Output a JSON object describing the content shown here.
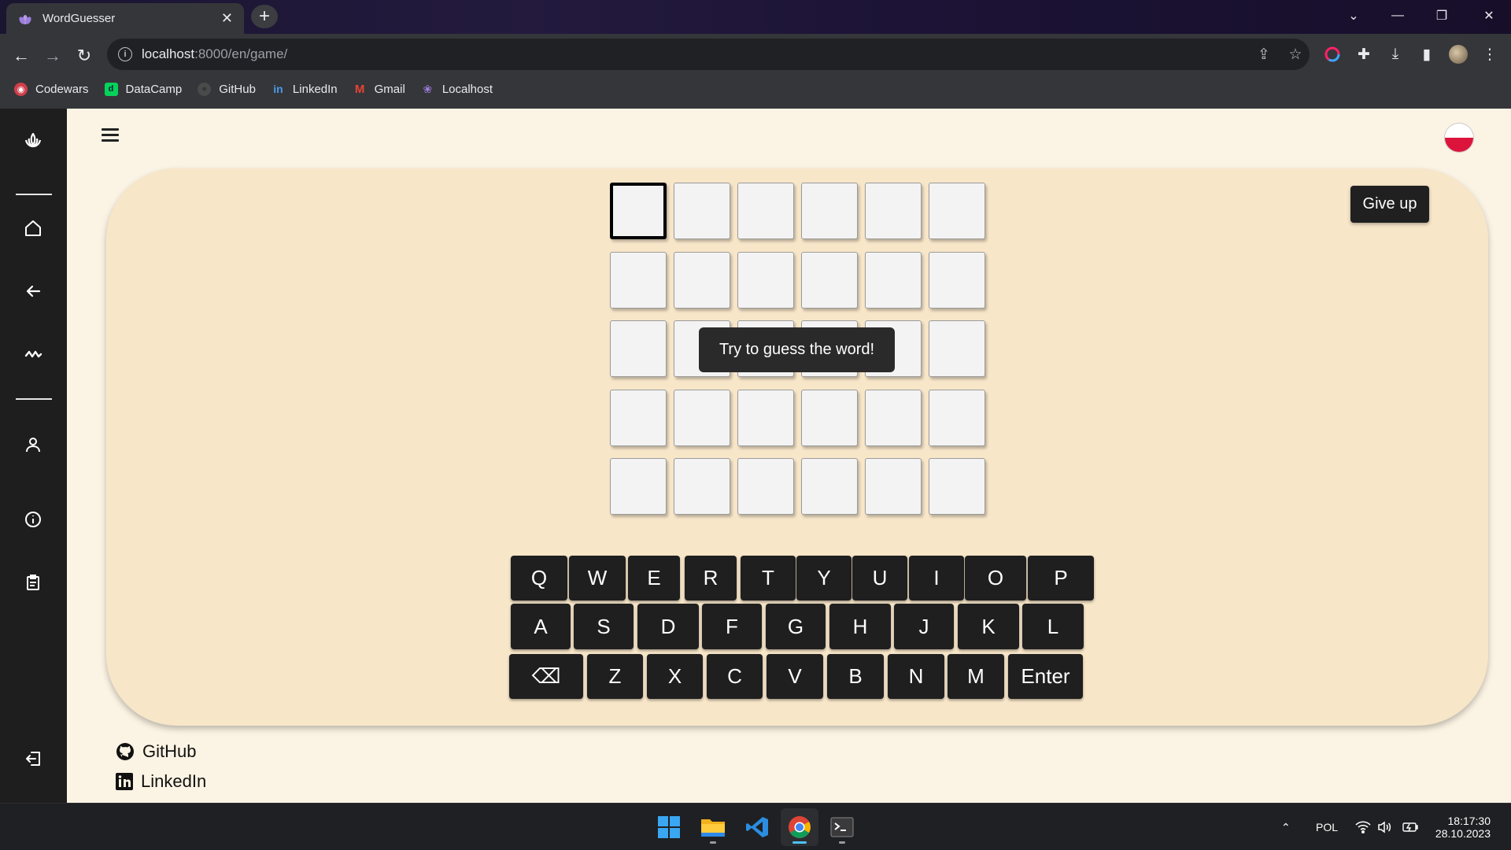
{
  "browser": {
    "tab_title": "WordGuesser",
    "new_tab_symbol": "+",
    "close_symbol": "✕",
    "url_host": "localhost",
    "url_path": ":8000/en/game/",
    "bookmarks": [
      {
        "label": "Codewars",
        "color": "#d0404c"
      },
      {
        "label": "DataCamp",
        "color": "#05d359"
      },
      {
        "label": "GitHub",
        "color": "#c9c9c9"
      },
      {
        "label": "LinkedIn",
        "color": "#1d79c9"
      },
      {
        "label": "Gmail",
        "color": "#ea4335"
      },
      {
        "label": "Localhost",
        "color": "#9a7cd8"
      }
    ]
  },
  "page": {
    "give_up_label": "Give up",
    "tooltip": "Try to guess the word!",
    "grid": {
      "rows": 5,
      "cols": 6,
      "active_row": 0,
      "active_col": 0
    },
    "keyboard": {
      "row1": [
        "Q",
        "W",
        "E",
        "R",
        "T",
        "Y",
        "U",
        "I",
        "O",
        "P"
      ],
      "row2": [
        "A",
        "S",
        "D",
        "F",
        "G",
        "H",
        "J",
        "K",
        "L"
      ],
      "row3": [
        "⌫",
        "Z",
        "X",
        "C",
        "V",
        "B",
        "N",
        "M",
        "Enter"
      ]
    },
    "footer": {
      "github": "GitHub",
      "linkedin": "LinkedIn"
    },
    "colors": {
      "sidebar": "#1e1e1e",
      "background": "#fbf3e3",
      "board": "#f8e6c9",
      "key": "#1f1f1f"
    }
  },
  "taskbar": {
    "language": "POL",
    "time": "18:17:30",
    "date": "28.10.2023"
  }
}
